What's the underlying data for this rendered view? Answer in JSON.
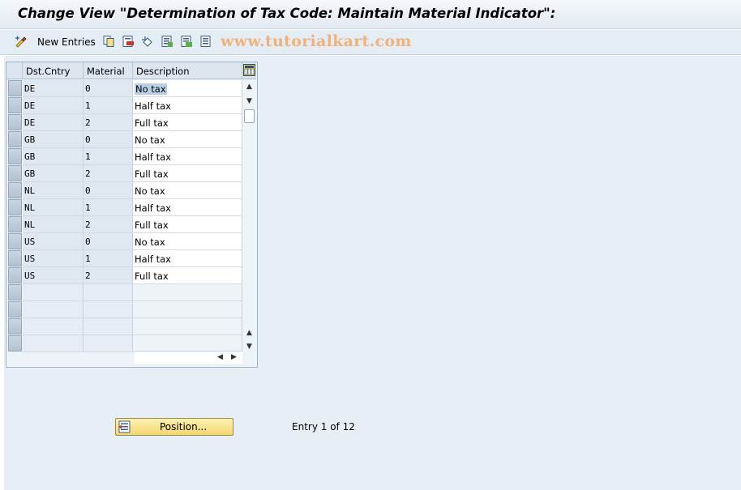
{
  "window": {
    "title": "Change View \"Determination of Tax Code: Maintain Material Indicator\":"
  },
  "toolbar": {
    "new_entries_label": "New Entries",
    "icons": [
      "change-display-icon",
      "copy-icon",
      "delete-icon",
      "undo-icon",
      "select-all-icon",
      "select-block-icon",
      "deselect-all-icon"
    ]
  },
  "watermark": "www.tutorialkart.com",
  "table": {
    "columns": [
      "Dst.Cntry",
      "Material",
      "Description"
    ],
    "rows": [
      {
        "country": "DE",
        "material": "0",
        "description": "No tax"
      },
      {
        "country": "DE",
        "material": "1",
        "description": "Half tax"
      },
      {
        "country": "DE",
        "material": "2",
        "description": "Full tax"
      },
      {
        "country": "GB",
        "material": "0",
        "description": "No tax"
      },
      {
        "country": "GB",
        "material": "1",
        "description": "Half tax"
      },
      {
        "country": "GB",
        "material": "2",
        "description": "Full tax"
      },
      {
        "country": "NL",
        "material": "0",
        "description": "No tax"
      },
      {
        "country": "NL",
        "material": "1",
        "description": "Half tax"
      },
      {
        "country": "NL",
        "material": "2",
        "description": "Full tax"
      },
      {
        "country": "US",
        "material": "0",
        "description": "No tax"
      },
      {
        "country": "US",
        "material": "1",
        "description": "Half tax"
      },
      {
        "country": "US",
        "material": "2",
        "description": "Full tax"
      }
    ],
    "empty_rows": 4
  },
  "footer": {
    "position_label": "Position...",
    "entry_info": "Entry 1 of 12"
  },
  "colors": {
    "position_button": "#f3d66e",
    "watermark": "#f0b27a",
    "selection_highlight": "#b9cfe6"
  }
}
